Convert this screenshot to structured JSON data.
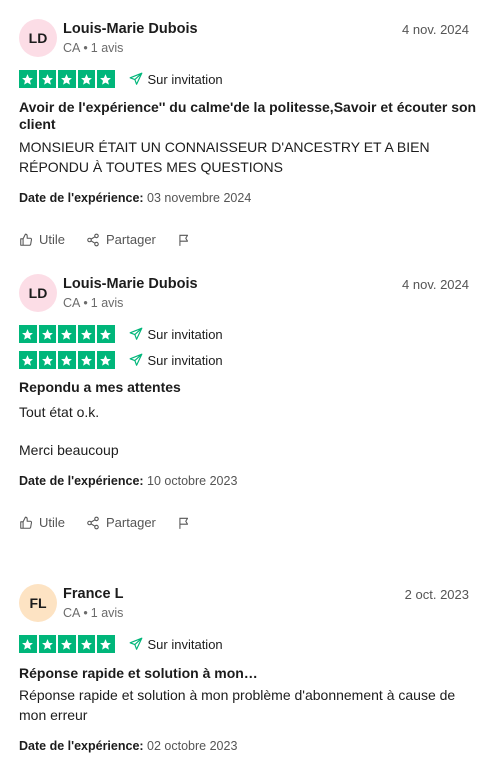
{
  "reviews": [
    {
      "initials": "LD",
      "avatar_color": "#fcdde6",
      "name": "Louis-Marie Dubois",
      "country": "CA",
      "review_count": "1 avis",
      "date": "4 nov. 2024",
      "rating_rows": [
        {
          "stars": 5,
          "label": "Sur invitation"
        }
      ],
      "title": "Avoir de l'expérience'' du calme'de la politesse,Savoir et écouter son client",
      "body_lines": [
        "MONSIEUR ÉTAIT UN CONNAISSEUR D'ANCESTRY ET A BIEN RÉPONDU À TOUTES MES QUESTIONS"
      ],
      "experience_label": "Date de l'expérience:",
      "experience_date": "03 novembre 2024",
      "useful_label": "Utile",
      "share_label": "Partager"
    },
    {
      "initials": "LD",
      "avatar_color": "#fcdde6",
      "name": "Louis-Marie Dubois",
      "country": "CA",
      "review_count": "1 avis",
      "date": "4 nov. 2024",
      "rating_rows": [
        {
          "stars": 5,
          "label": "Sur invitation"
        },
        {
          "stars": 5,
          "label": "Sur invitation"
        }
      ],
      "title": "Repondu a mes attentes",
      "body_lines": [
        "Tout état o.k.",
        "Merci beaucoup"
      ],
      "experience_label": "Date de l'expérience:",
      "experience_date": "10 octobre 2023",
      "useful_label": "Utile",
      "share_label": "Partager"
    },
    {
      "initials": "FL",
      "avatar_color": "#fde3c3",
      "name": "France L",
      "country": "CA",
      "review_count": "1 avis",
      "date": "2 oct. 2023",
      "rating_rows": [
        {
          "stars": 5,
          "label": "Sur invitation"
        }
      ],
      "title": "Réponse rapide et solution à mon…",
      "body_lines": [
        "Réponse rapide et solution à mon problème d'abonnement à cause de mon erreur"
      ],
      "experience_label": "Date de l'expérience:",
      "experience_date": "02 octobre 2023"
    }
  ],
  "colors": {
    "star_green": "#00b67a",
    "avatar_pink": "#fcdde6",
    "avatar_orange": "#fde3c3"
  }
}
